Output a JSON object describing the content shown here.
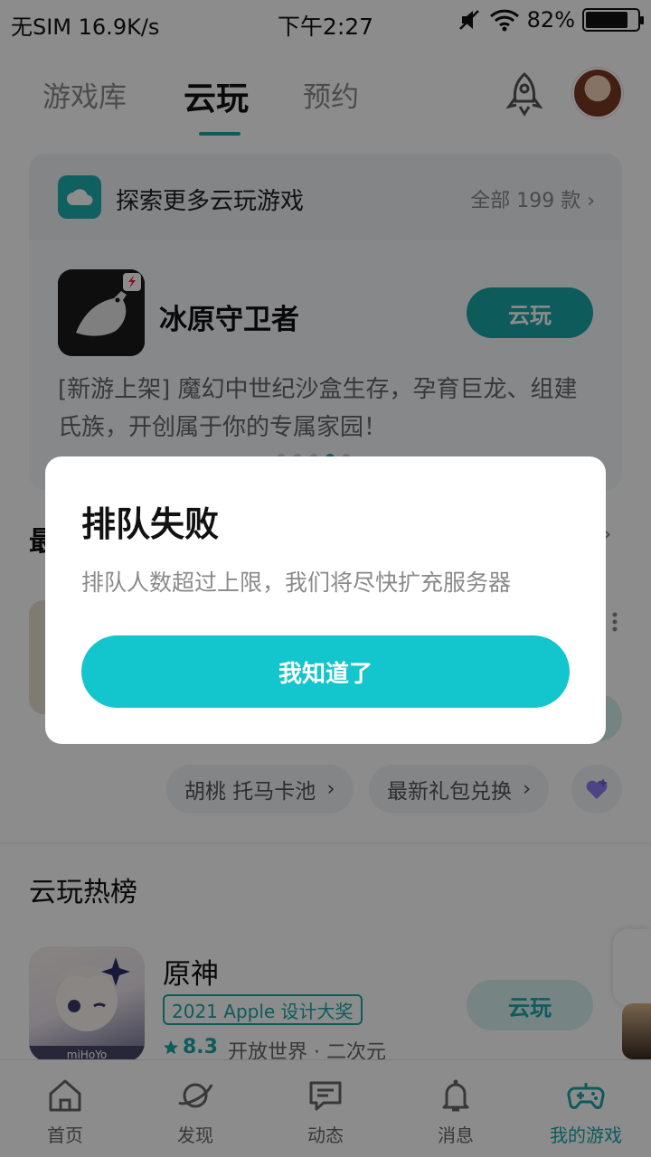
{
  "status_bar": {
    "left": "无SIM 16.9K/s",
    "time": "下午2:27",
    "battery_text": "82%",
    "battery_level": 0.82
  },
  "top_tabs": [
    {
      "label": "游戏库"
    },
    {
      "label": "云玩"
    },
    {
      "label": "预约"
    }
  ],
  "cloud_card": {
    "title": "探索更多云玩游戏",
    "all_link": "全部 199 款",
    "game_name": "冰原守卫者",
    "play_button": "云玩",
    "description": "[新游上架] 魔幻中世纪沙盒生存，孕育巨龙、组建氏族，开创属于你的专属家园！"
  },
  "chips": [
    {
      "label": "胡桃 托马卡池"
    },
    {
      "label": "最新礼包兑换"
    }
  ],
  "hot_section": {
    "title": "云玩热榜",
    "game_name": "原神",
    "award": "2021 Apple 设计大奖",
    "rating": "8.3",
    "tags": "开放世界 · 二次元",
    "play_button": "云玩",
    "icon_caption": "miHoYo"
  },
  "bottom_nav": [
    {
      "label": "首页"
    },
    {
      "label": "发现"
    },
    {
      "label": "动态"
    },
    {
      "label": "消息"
    },
    {
      "label": "我的游戏"
    }
  ],
  "dialog": {
    "title": "排队失败",
    "message": "排队人数超过上限，我们将尽快扩充服务器",
    "confirm": "我知道了"
  },
  "colors": {
    "accent": "#1aa6a6",
    "dialog_button": "#13c5cc"
  }
}
